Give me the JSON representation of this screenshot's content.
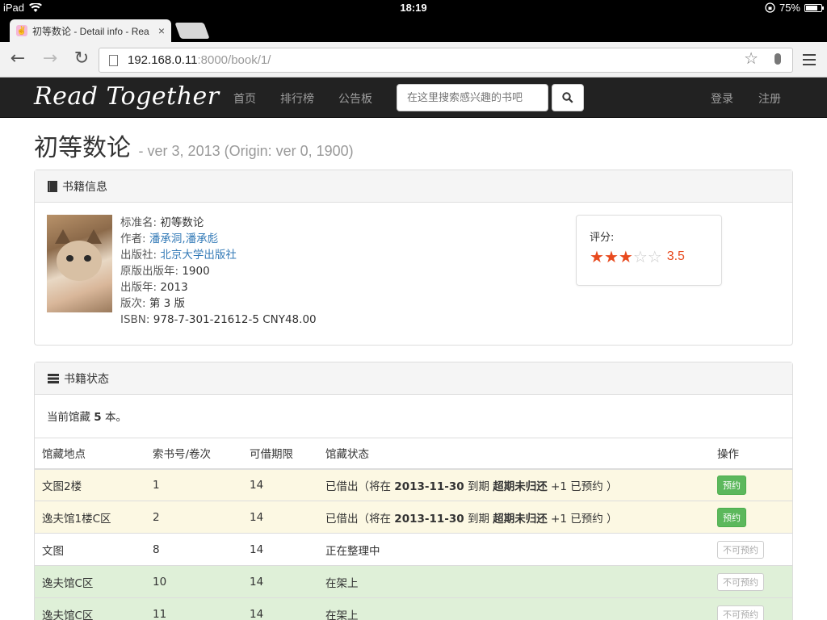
{
  "status_bar": {
    "device": "iPad",
    "time": "18:19",
    "battery": "75%",
    "battery_level": 0.75
  },
  "browser": {
    "tab_title": "初等数论 - Detail info - Rea",
    "tab_close": "×",
    "url_host": "192.168.0.11",
    "url_path": ":8000/book/1/"
  },
  "navbar": {
    "brand": "Read Together",
    "links": [
      "首页",
      "排行榜",
      "公告板"
    ],
    "search_placeholder": "在这里搜索感兴趣的书吧",
    "login": "登录",
    "register": "注册"
  },
  "book": {
    "title": "初等数论",
    "subtitle": "- ver 3, 2013 (Origin: ver 0, 1900)",
    "info_panel_title": "书籍信息",
    "fields": {
      "std_name_label": "标准名: ",
      "std_name": "初等数论",
      "author_label": "作者: ",
      "author1": "潘承洞",
      "author_sep": ",",
      "author2": "潘承彪",
      "publisher_label": "出版社: ",
      "publisher": "北京大学出版社",
      "orig_year_label": "原版出版年: ",
      "orig_year": "1900",
      "year_label": "出版年: ",
      "year": "2013",
      "edition_label": "版次: ",
      "edition": "第 3 版",
      "isbn_label": "ISBN: ",
      "isbn": "978-7-301-21612-5 CNY48.00"
    },
    "rating_label": "评分:",
    "rating_value": "3.5",
    "rating_stars": 3.5
  },
  "status_panel": {
    "title": "书籍状态",
    "count_prefix": "当前馆藏 ",
    "count": "5",
    "count_suffix": " 本。",
    "columns": [
      "馆藏地点",
      "索书号/卷次",
      "可借期限",
      "馆藏状态",
      "操作"
    ],
    "rows": [
      {
        "location": "文图2楼",
        "callno": "1",
        "period": "14",
        "status_pre": "已借出（将在 ",
        "status_date": "2013-11-30",
        "status_mid": " 到期 ",
        "status_bold": "超期未归还",
        "status_post": " +1 已预约 ）",
        "action": "预约",
        "kind": "warning"
      },
      {
        "location": "逸夫馆1楼C区",
        "callno": "2",
        "period": "14",
        "status_pre": "已借出（将在 ",
        "status_date": "2013-11-30",
        "status_mid": " 到期 ",
        "status_bold": "超期未归还",
        "status_post": " +1 已预约 ）",
        "action": "预约",
        "kind": "warning"
      },
      {
        "location": "文图",
        "callno": "8",
        "period": "14",
        "status": "正在整理中",
        "action": "不可预约",
        "kind": "default"
      },
      {
        "location": "逸夫馆C区",
        "callno": "10",
        "period": "14",
        "status": "在架上",
        "action": "不可预约",
        "kind": "success"
      },
      {
        "location": "逸夫馆C区",
        "callno": "11",
        "period": "14",
        "status": "在架上",
        "action": "不可预约",
        "kind": "success"
      }
    ]
  }
}
